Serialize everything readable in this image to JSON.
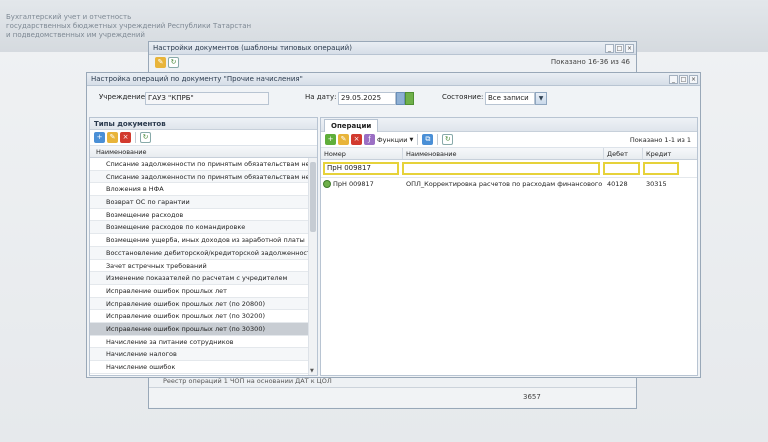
{
  "app": {
    "header_lines": [
      "Бухгалтерский учет и отчетность",
      "государственных бюджетных учреждений Республики Татарстан",
      "и подведомственных им учреждений"
    ]
  },
  "background_window": {
    "title": "Настройки документов (шаблоны типовых операций)",
    "shown": "Показано 16-36 из 46",
    "bottom_row": "Реестр операций 1 ЧОП на основании ДАТ к ЦОЛ",
    "bottom_value": "3657"
  },
  "dialog": {
    "title": "Настройка операций по документу \"Прочие начисления\"",
    "institution_label": "Учреждение:",
    "institution_value": "ГАУЗ \"КПРБ\"",
    "date_label": "На дату:",
    "date_value": "29.05.2025",
    "state_label": "Состояние:",
    "state_value": "Все записи"
  },
  "doc_types": {
    "title": "Типы документов",
    "column": "Наименование",
    "items": [
      "Списание задолженности по принятым обязательствам не во...",
      "Списание задолженности по принятым обязательствам не во...",
      "Вложения в НФА",
      "Возврат ОС по гарантии",
      "Возмещение расходов",
      "Возмещение расходов по командировке",
      "Возмещение ущерба, иных доходов из заработной платы",
      "Восстановление дебиторской/кредиторской задолженности",
      "Зачет встречных требований",
      "Изменение показателей по расчетам с учредителем",
      "Исправление ошибок прошлых лет",
      "Исправление ошибок прошлых лет (по 20800)",
      "Исправление ошибок прошлых лет (по 30200)",
      "Исправление ошибок прошлых лет (по 30300)",
      "Начисление за питание сотрудников",
      "Начисление налогов",
      "Начисление ошибок"
    ],
    "selected_index": 13
  },
  "operations": {
    "tab": "Операции",
    "functions_label": "Функции",
    "shown": "Показано 1-1 из 1",
    "columns": [
      "Номер",
      "Наименование",
      "Дебет",
      "Кредит"
    ],
    "filter_number": "ПрН 009817",
    "rows": [
      {
        "number": "ПрН 009817",
        "name": "ОПЛ_Корректировка расчетов по расходам финансового го...",
        "debit": "40128",
        "credit": "30315"
      }
    ]
  }
}
